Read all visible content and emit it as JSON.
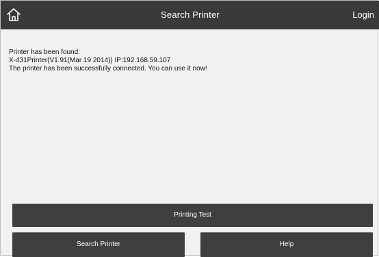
{
  "header": {
    "title": "Search Printer",
    "login_label": "Login",
    "home_icon": "home-icon"
  },
  "message": {
    "line1": "Printer has been found:",
    "line2": "X-431Printer(V1.91(Mar 19 2014))  IP:192.168.59.107",
    "line3": "The printer has been successfully connected. You can use it now!"
  },
  "buttons": {
    "printing_test": "Printing Test",
    "search_printer": "Search Printer",
    "help": "Help"
  },
  "colors": {
    "header_bg": "#3a3a3a",
    "button_bg": "#3f3f3f",
    "content_bg": "#f1f1f1"
  }
}
